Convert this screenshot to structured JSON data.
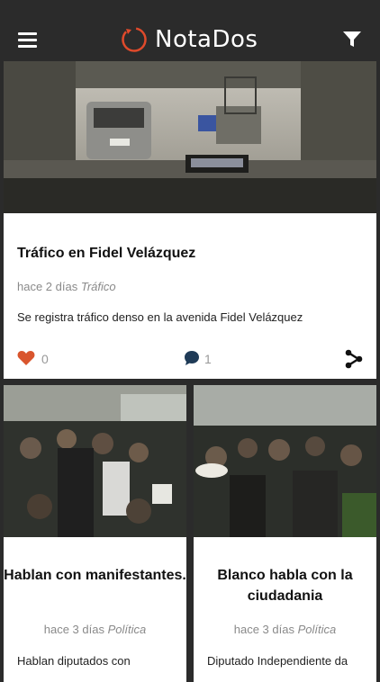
{
  "app": {
    "name": "NotaDos"
  },
  "header": {
    "menu_icon": "hamburger-menu-icon",
    "filter_icon": "filter-funnel-icon",
    "brand_color": "#e04a2b"
  },
  "feed": {
    "featured": {
      "title": "Tráfico en Fidel Velázquez",
      "time": "hace 2 días",
      "category": "Tráfico",
      "summary": "Se registra tráfico denso en la avenida Fidel Velázquez",
      "likes": "0",
      "comments": "1",
      "image": "traffic-photo"
    },
    "cards": [
      {
        "title": "Hablan con manifestantes.",
        "time": "hace 3 días",
        "category": "Política",
        "summary": "Hablan diputados con",
        "image": "crowd-protest-photo"
      },
      {
        "title": "Blanco habla con la ciudadania",
        "time": "hace 3 días",
        "category": "Política",
        "summary": "Diputado Independiente da",
        "image": "crowd-meeting-photo"
      }
    ]
  },
  "colors": {
    "heart": "#d9552d",
    "comment": "#1f3b57",
    "appbar": "#2b2b2b"
  }
}
